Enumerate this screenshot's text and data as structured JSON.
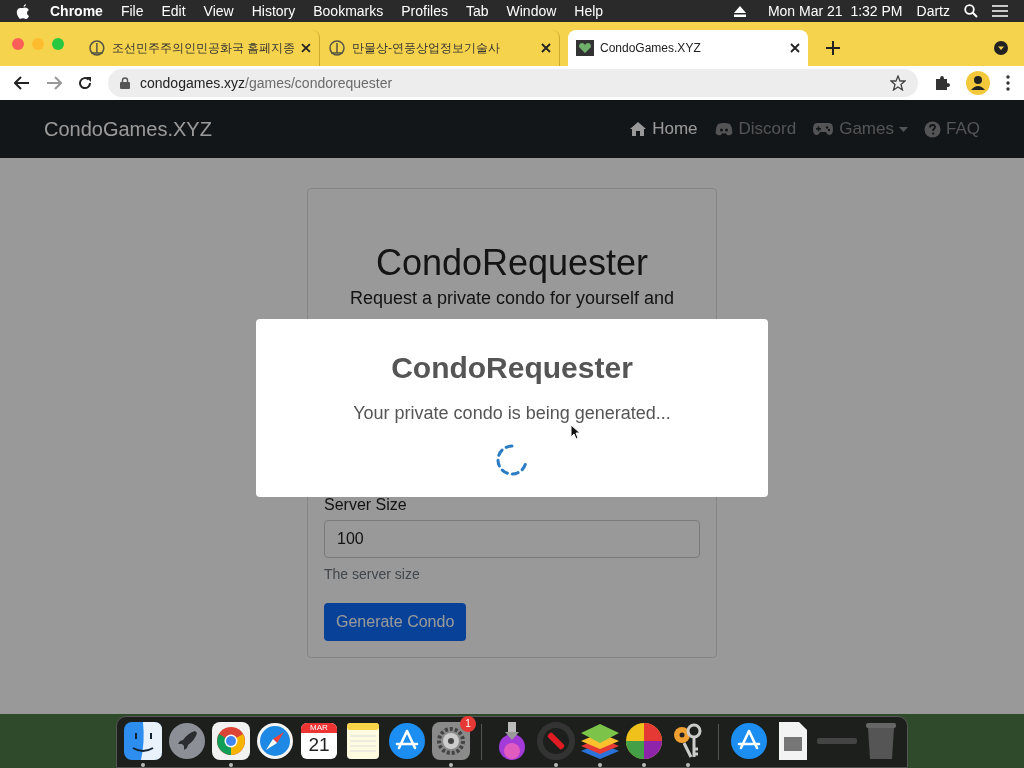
{
  "menu_bar": {
    "app": "Chrome",
    "menus": [
      "File",
      "Edit",
      "View",
      "History",
      "Bookmarks",
      "Profiles",
      "Tab",
      "Window",
      "Help"
    ],
    "clock": "Mon Mar 21  1:32 PM",
    "user": "Dartz"
  },
  "tabs": [
    {
      "title": "조선민주주의인민공화국 홈페지종",
      "selected": false
    },
    {
      "title": "만물상-연풍상업정보기술사",
      "selected": false
    },
    {
      "title": "CondoGames.XYZ",
      "selected": true
    }
  ],
  "address": {
    "host": "condogames.xyz",
    "path": "/games/condorequester"
  },
  "navbar": {
    "brand": "CondoGames.XYZ",
    "links": [
      {
        "label": "Home",
        "kind": "home",
        "selected": true
      },
      {
        "label": "Discord",
        "kind": "discord",
        "selected": false
      },
      {
        "label": "Games",
        "kind": "games",
        "selected": false
      },
      {
        "label": "FAQ",
        "kind": "faq",
        "selected": false
      }
    ]
  },
  "card": {
    "title": "CondoRequester",
    "subtitle": "Request a private condo for yourself and",
    "field": {
      "label": "Server Size",
      "value": "100",
      "help": "The server size"
    },
    "button": "Generate Condo"
  },
  "modal": {
    "title": "CondoRequester",
    "message": "Your private condo is being generated..."
  },
  "dock": {
    "calendar_month": "MAR",
    "calendar_day": "21",
    "settings_badge": "1",
    "apps": [
      {
        "kind": "finder",
        "running": true
      },
      {
        "kind": "launchpad",
        "running": false
      },
      {
        "kind": "chrome",
        "running": true
      },
      {
        "kind": "safari",
        "running": false
      },
      {
        "kind": "calendar",
        "running": false
      },
      {
        "kind": "notes",
        "running": false
      },
      {
        "kind": "appstore",
        "running": false
      },
      {
        "kind": "settings",
        "running": true
      },
      {
        "kind": "separator"
      },
      {
        "kind": "installer",
        "running": false
      },
      {
        "kind": "redapp",
        "running": true
      },
      {
        "kind": "stack",
        "running": true
      },
      {
        "kind": "ball",
        "running": true
      },
      {
        "kind": "keychain",
        "running": true
      },
      {
        "kind": "separator"
      },
      {
        "kind": "appstore",
        "running": false
      },
      {
        "kind": "document",
        "running": false
      },
      {
        "kind": "window",
        "running": false
      },
      {
        "kind": "trash",
        "running": false
      }
    ]
  }
}
